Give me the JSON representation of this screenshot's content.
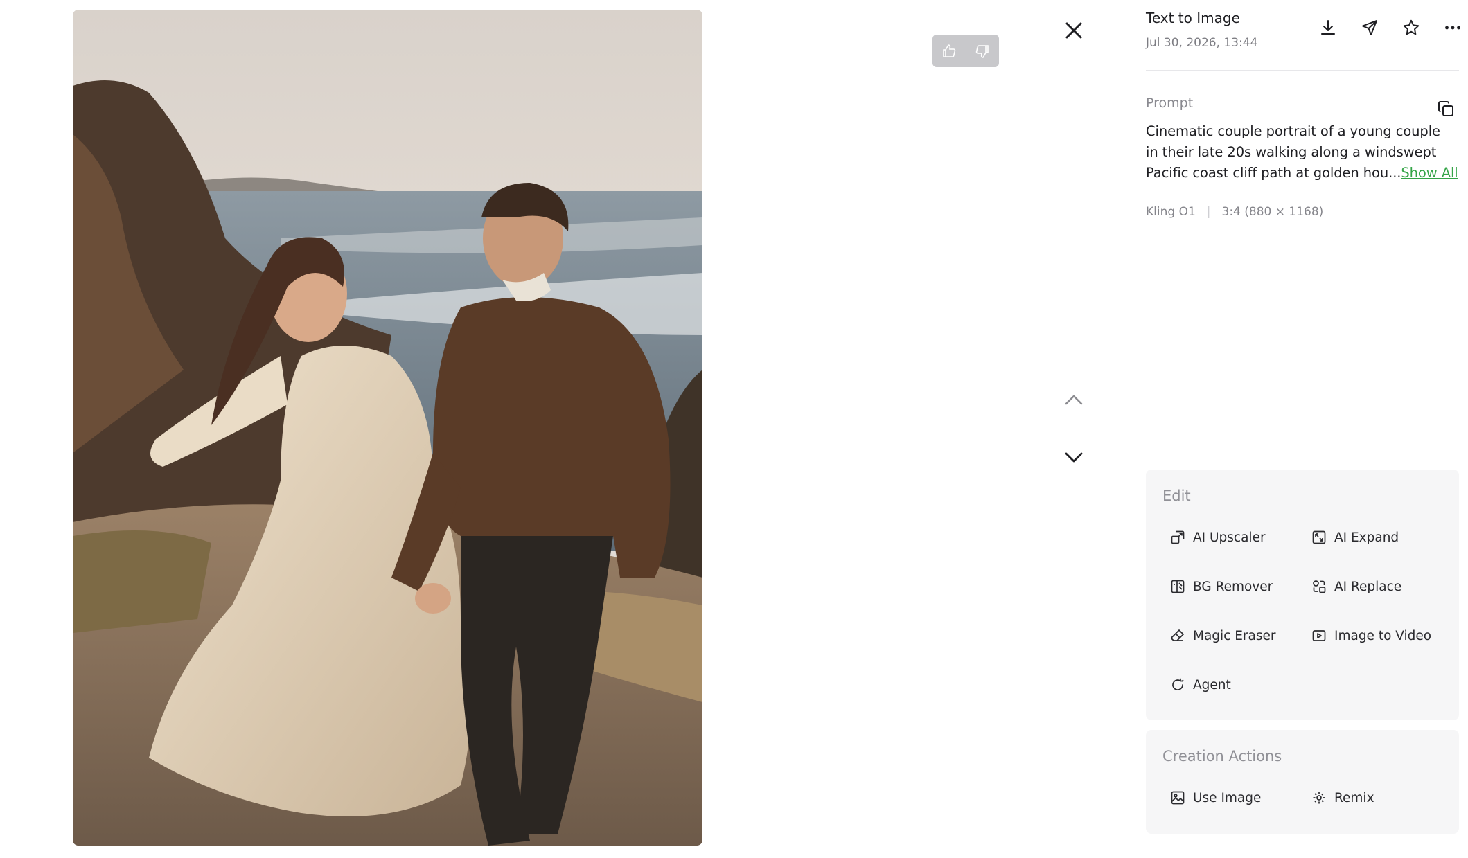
{
  "header": {
    "title": "Text to Image",
    "date": "Jul 30, 2026, 13:44"
  },
  "toolbar": {
    "icons": [
      "download-icon",
      "share-icon",
      "star-icon",
      "more-icon"
    ]
  },
  "prompt": {
    "label": "Prompt",
    "lines": [
      "Cinematic couple portrait of a young couple",
      "in their late 20s walking along a windswept",
      "Pacific coast cliff path at golden hou..."
    ],
    "show_all": "Show All"
  },
  "meta": {
    "model": "Kling O1",
    "size": "3:4 (880 × 1168)"
  },
  "edit": {
    "title": "Edit",
    "items": [
      {
        "label": "AI Upscaler",
        "icon": "upscale-icon"
      },
      {
        "label": "AI Expand",
        "icon": "expand-icon"
      },
      {
        "label": "BG Remover",
        "icon": "bg-remover-icon"
      },
      {
        "label": "AI Replace",
        "icon": "replace-icon"
      },
      {
        "label": "Magic Eraser",
        "icon": "eraser-icon"
      },
      {
        "label": "Image to Video",
        "icon": "video-icon"
      },
      {
        "label": "Agent",
        "icon": "agent-icon"
      }
    ]
  },
  "creation": {
    "title": "Creation Actions",
    "items": [
      {
        "label": "Use Image",
        "icon": "image-icon"
      },
      {
        "label": "Remix",
        "icon": "remix-icon"
      }
    ]
  },
  "colors": {
    "accent": "#34a447",
    "text": "#1e1e22",
    "muted": "#85858b",
    "card": "#f6f6f7"
  }
}
